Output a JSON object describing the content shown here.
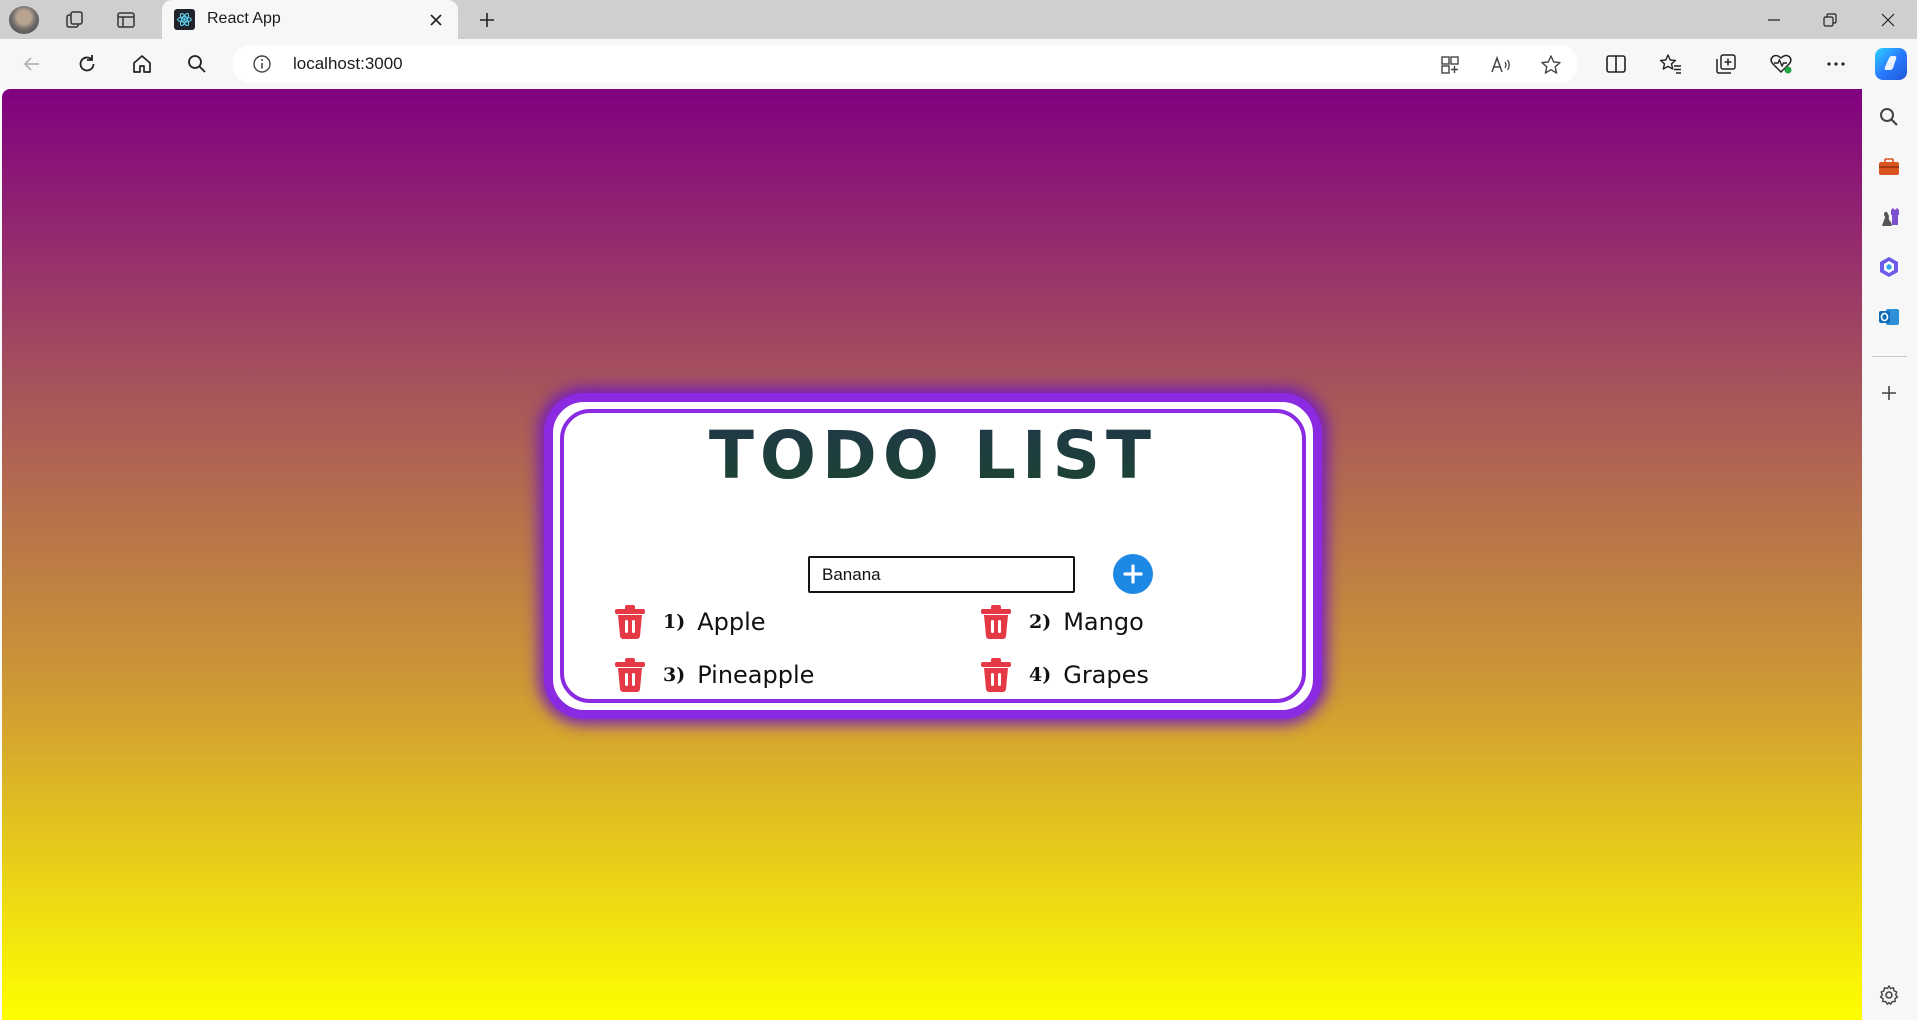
{
  "browser": {
    "tab": {
      "title": "React App"
    },
    "address": {
      "url": "localhost:3000"
    }
  },
  "todo": {
    "title": "TODO LIST",
    "input": {
      "value": "Banana"
    },
    "items": [
      {
        "number": "1)",
        "text": "Apple"
      },
      {
        "number": "2)",
        "text": "Mango"
      },
      {
        "number": "3)",
        "text": "Pineapple"
      },
      {
        "number": "4)",
        "text": "Grapes"
      }
    ]
  },
  "colors": {
    "page_gradient": [
      "#800080",
      "#ffff00"
    ],
    "card_border": "#8a2be2",
    "title_text": "#1b4530",
    "add_button": "#1e88e5",
    "delete_icon": "#e53945"
  },
  "icons": {
    "delete": "trash-icon",
    "add": "plus-circle-icon"
  }
}
